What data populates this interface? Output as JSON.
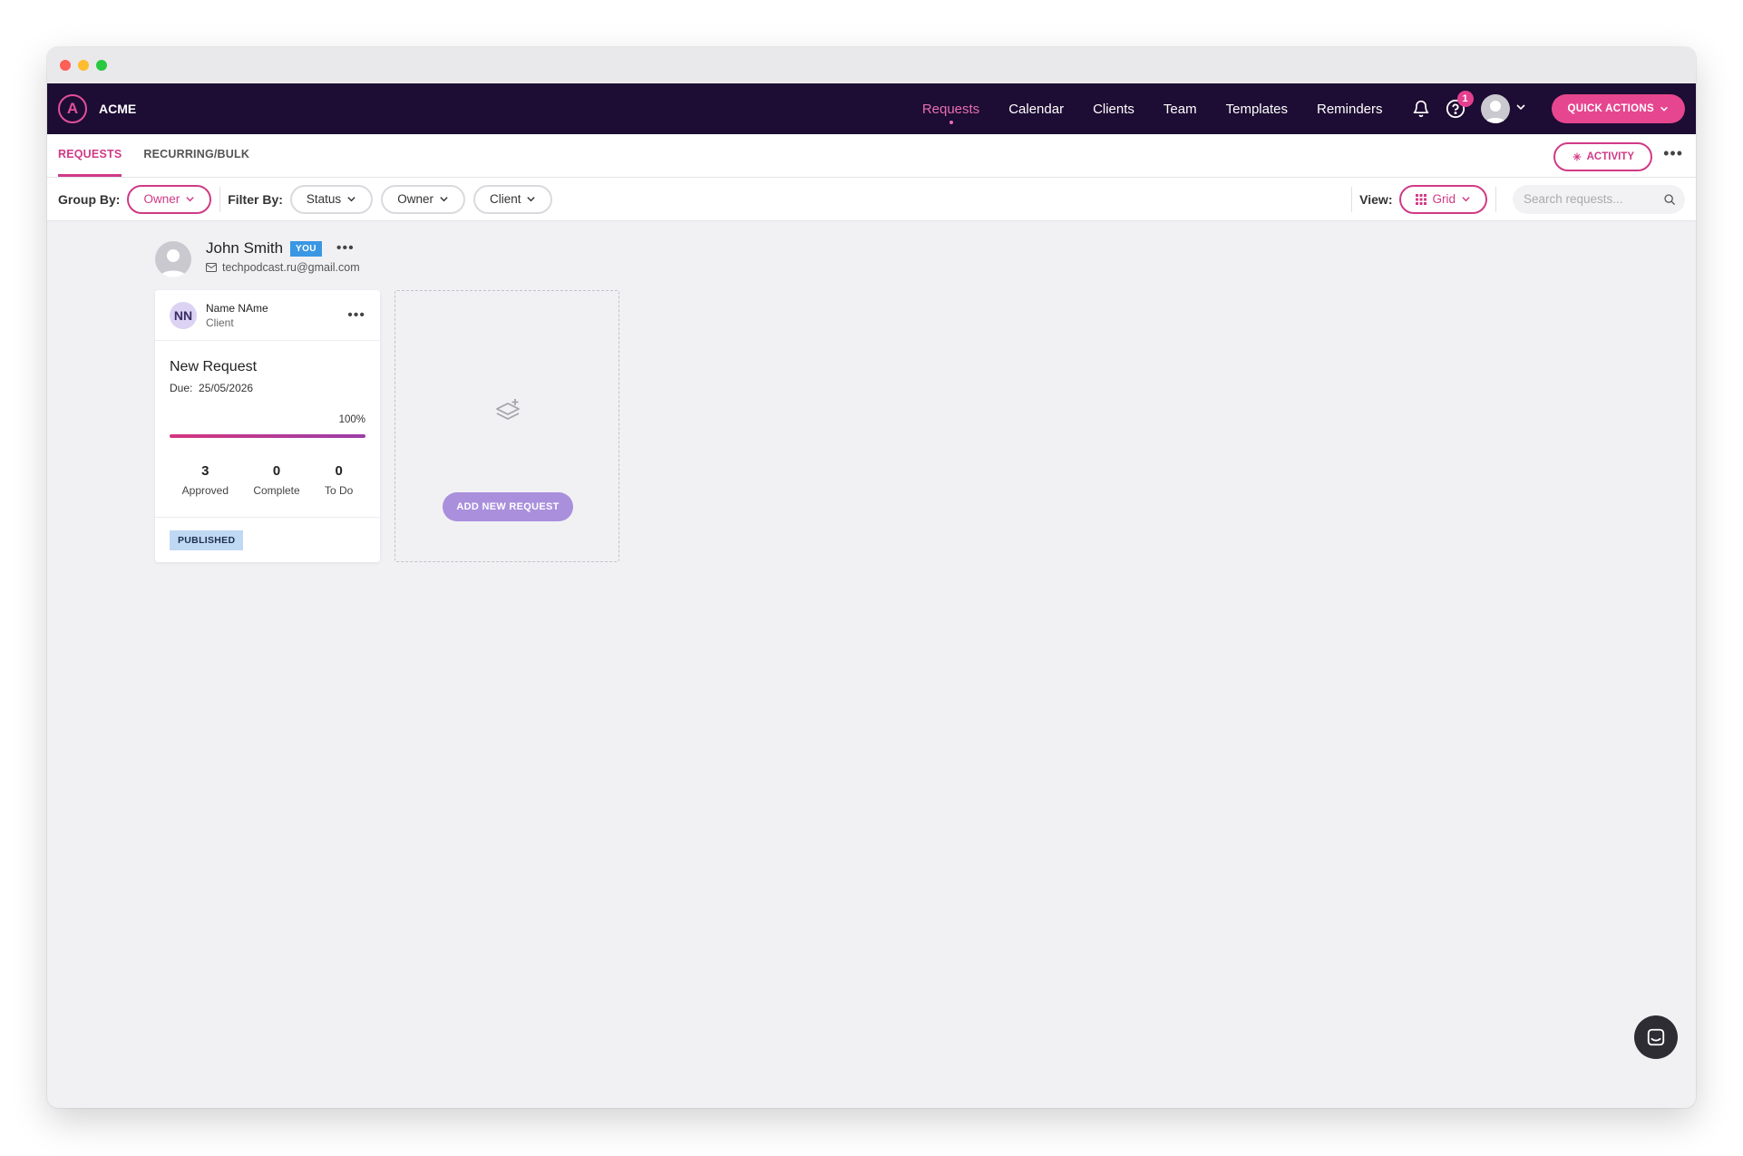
{
  "brand": {
    "logo_letter": "A",
    "name": "ACME"
  },
  "nav": {
    "links": [
      {
        "label": "Requests",
        "active": true
      },
      {
        "label": "Calendar",
        "active": false
      },
      {
        "label": "Clients",
        "active": false
      },
      {
        "label": "Team",
        "active": false
      },
      {
        "label": "Templates",
        "active": false
      },
      {
        "label": "Reminders",
        "active": false
      }
    ],
    "help_badge": "1",
    "icons": [
      "bell-icon",
      "help-icon",
      "avatar",
      "chevron-down-icon"
    ],
    "quick_actions": "QUICK ACTIONS"
  },
  "subnav": {
    "tabs": [
      {
        "label": "REQUESTS",
        "active": true
      },
      {
        "label": "RECURRING/BULK",
        "active": false
      }
    ],
    "activity": "ACTIVITY",
    "more": "•••"
  },
  "filters": {
    "group_by_label": "Group By:",
    "group_by_value": "Owner",
    "filter_by_label": "Filter By:",
    "filter_status": "Status",
    "filter_owner": "Owner",
    "filter_client": "Client",
    "view_label": "View:",
    "view_value": "Grid",
    "search_placeholder": "Search requests...",
    "search_value": ""
  },
  "owner": {
    "name": "John Smith",
    "badge": "YOU",
    "email": "techpodcast.ru@gmail.com",
    "more": "•••"
  },
  "card": {
    "client_initials": "NN",
    "client_name": "Name NAme",
    "client_role": "Client",
    "more": "•••",
    "title": "New Request",
    "due_label": "Due:",
    "due_date": "25/05/2026",
    "progress_text": "100%",
    "progress_value": 100,
    "stats": [
      {
        "value": "3",
        "label": "Approved"
      },
      {
        "value": "0",
        "label": "Complete"
      },
      {
        "value": "0",
        "label": "To Do"
      }
    ],
    "status": "PUBLISHED"
  },
  "add_card": {
    "button": "ADD NEW REQUEST"
  },
  "colors": {
    "navbar": "#1d0c33",
    "accent": "#d03a86",
    "quick_actions": "#e6468f",
    "add_button": "#a98fdc",
    "you_badge": "#3a97e3",
    "published_tag": "#bfd9f5"
  }
}
